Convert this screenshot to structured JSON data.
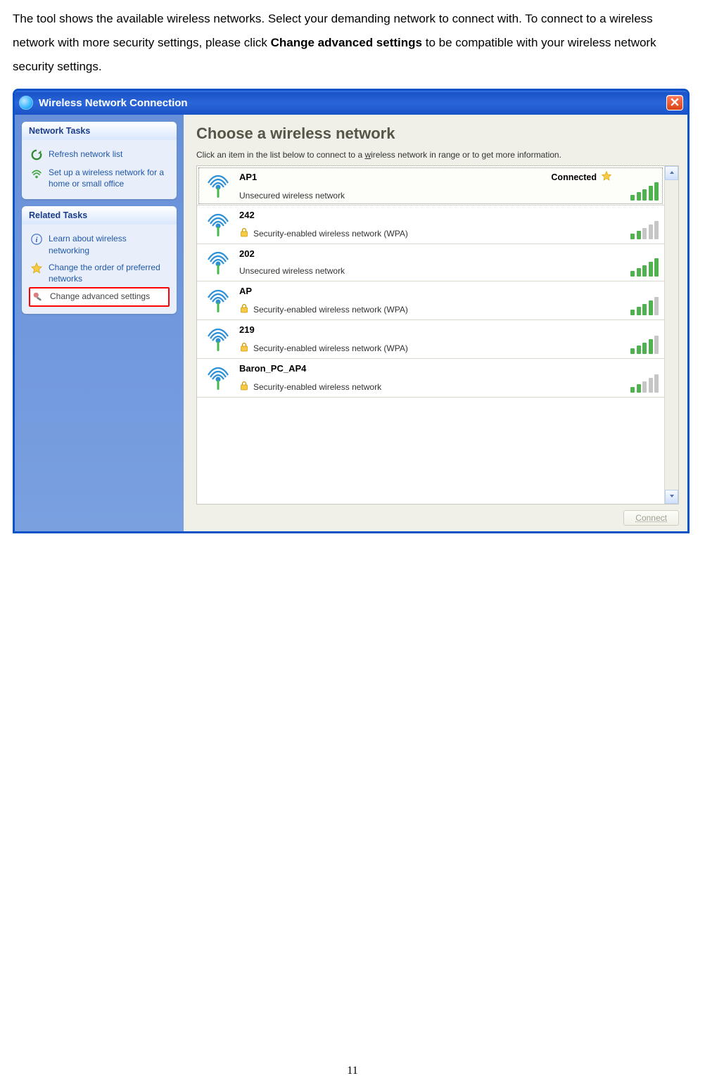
{
  "page": {
    "intro_part1": "The tool shows the available wireless networks. Select your demanding network to connect with. To connect to a wireless network with more security settings, please click ",
    "intro_bold": "Change advanced settings",
    "intro_part2": " to be compatible with your wireless network security settings.",
    "number": "11"
  },
  "window": {
    "title": "Wireless Network Connection",
    "heading": "Choose a wireless network",
    "list_intro_pre": "Click an item in the list below to connect to a ",
    "list_intro_underline_char": "w",
    "list_intro_post": "ireless network in range or to get more information.",
    "connect_label": "Connect"
  },
  "sidebar": {
    "panels": [
      {
        "title": "Network Tasks",
        "items": [
          {
            "label": "Refresh network list",
            "icon": "refresh"
          },
          {
            "label": "Set up a wireless network for a home or small office",
            "icon": "setup"
          }
        ]
      },
      {
        "title": "Related Tasks",
        "items": [
          {
            "label": "Learn about wireless networking",
            "icon": "info"
          },
          {
            "label": "Change the order of preferred networks",
            "icon": "star"
          },
          {
            "label": "Change advanced settings",
            "icon": "wrench",
            "highlight": true
          }
        ]
      }
    ]
  },
  "networks": [
    {
      "name": "AP1",
      "desc": "Unsecured wireless network",
      "status": "Connected",
      "star": true,
      "lock": false,
      "bars": 5
    },
    {
      "name": "242",
      "desc": "Security-enabled wireless network (WPA)",
      "status": "",
      "star": false,
      "lock": true,
      "bars": 2
    },
    {
      "name": "202",
      "desc": "Unsecured wireless network",
      "status": "",
      "star": false,
      "lock": false,
      "bars": 5
    },
    {
      "name": "AP",
      "desc": "Security-enabled wireless network (WPA)",
      "status": "",
      "star": false,
      "lock": true,
      "bars": 4
    },
    {
      "name": "219",
      "desc": "Security-enabled wireless network (WPA)",
      "status": "",
      "star": false,
      "lock": true,
      "bars": 4
    },
    {
      "name": "Baron_PC_AP4",
      "desc": "Security-enabled wireless network",
      "status": "",
      "star": false,
      "lock": true,
      "bars": 2
    }
  ]
}
